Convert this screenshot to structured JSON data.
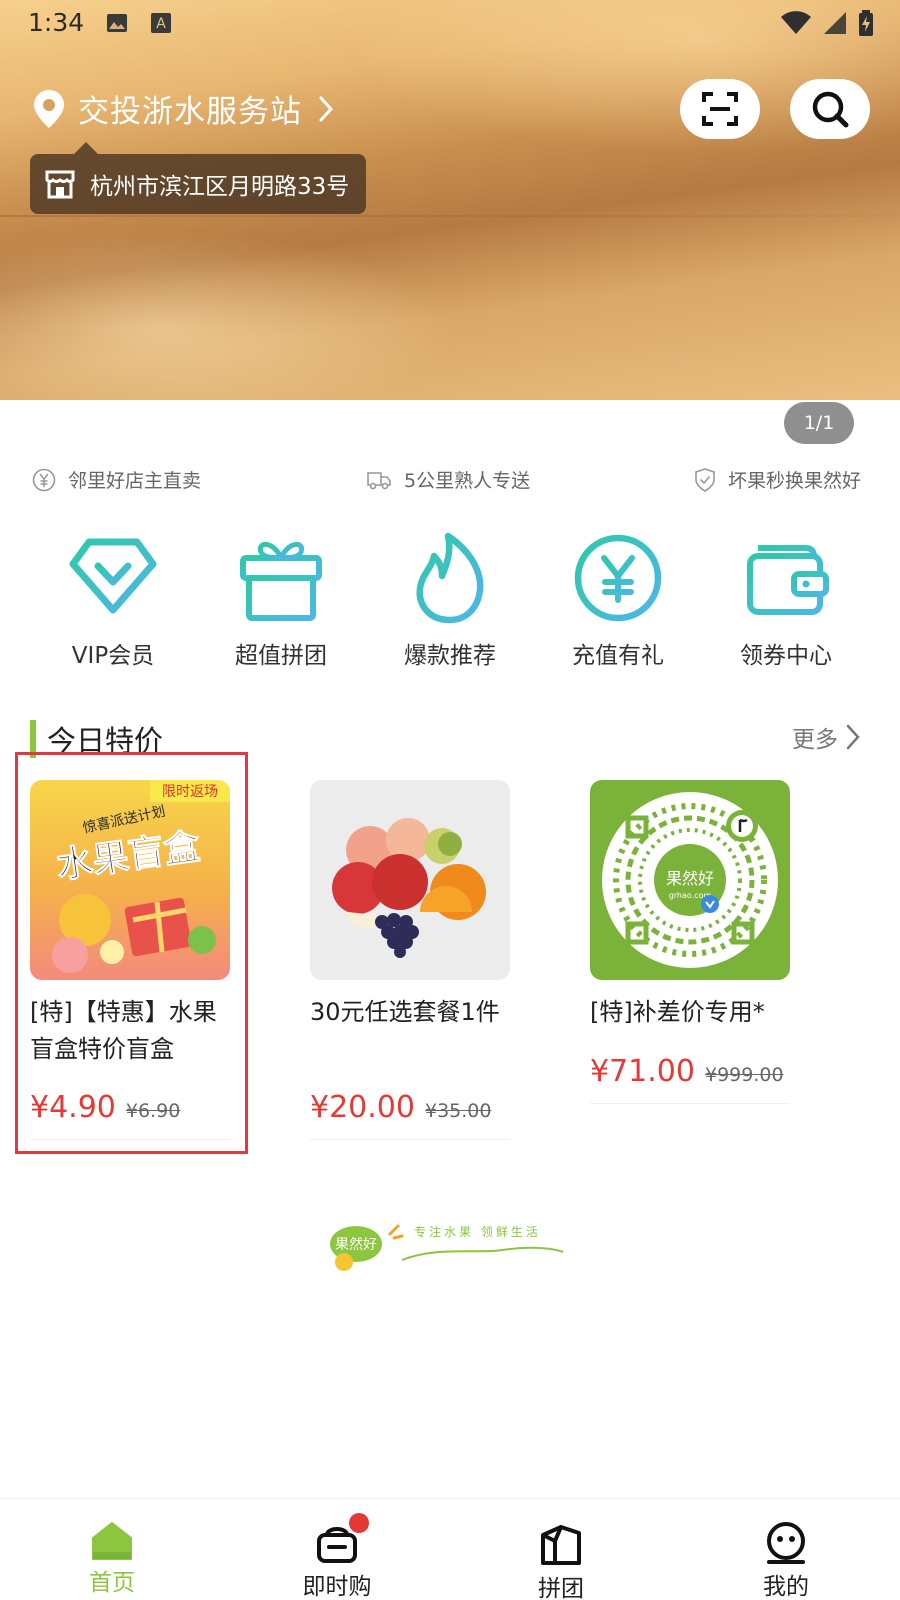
{
  "status_bar": {
    "time": "1:34"
  },
  "header": {
    "store_name": "交投浙水服务站",
    "address": "杭州市滨江区月明路33号",
    "pager": "1/1"
  },
  "features": [
    {
      "label": "邻里好店主直卖",
      "icon": "yen-circle-icon"
    },
    {
      "label": "5公里熟人专送",
      "icon": "delivery-truck-icon"
    },
    {
      "label": "坏果秒换果然好",
      "icon": "shield-check-icon"
    }
  ],
  "categories": [
    {
      "label": "VIP会员",
      "icon": "vip-diamond-icon"
    },
    {
      "label": "超值拼团",
      "icon": "gift-icon"
    },
    {
      "label": "爆款推荐",
      "icon": "flame-icon"
    },
    {
      "label": "充值有礼",
      "icon": "yen-coin-icon"
    },
    {
      "label": "领券中心",
      "icon": "wallet-icon"
    }
  ],
  "section": {
    "title": "今日特价",
    "more": "更多"
  },
  "products": [
    {
      "name": "[特]【特惠】水果盲盒特价盲盒",
      "price": "¥4.90",
      "old_price": "¥6.90",
      "image_text": {
        "tag": "限时返场",
        "line1": "惊喜派送计划",
        "line2": "水果盲盒"
      }
    },
    {
      "name": "30元任选套餐1件",
      "price": "¥20.00",
      "old_price": "¥35.00"
    },
    {
      "name": "[特]补差价专用*",
      "price": "¥71.00",
      "old_price": "¥999.00",
      "image_text": {
        "brand": "果然好",
        "site": "grhao.com"
      }
    }
  ],
  "brand_footer": {
    "name": "果然好",
    "slogan": "专注水果 领鲜生活"
  },
  "tabs": [
    {
      "label": "首页",
      "icon": "home-icon",
      "active": true
    },
    {
      "label": "即时购",
      "icon": "shopping-basket-icon",
      "active": false
    },
    {
      "label": "拼团",
      "icon": "group-box-icon",
      "active": false
    },
    {
      "label": "我的",
      "icon": "user-face-icon",
      "active": false
    }
  ],
  "colors": {
    "accent_green": "#8cc63f",
    "price_red": "#e53935",
    "icon_teal_start": "#2ec9a8",
    "icon_teal_end": "#4fb6e8"
  }
}
